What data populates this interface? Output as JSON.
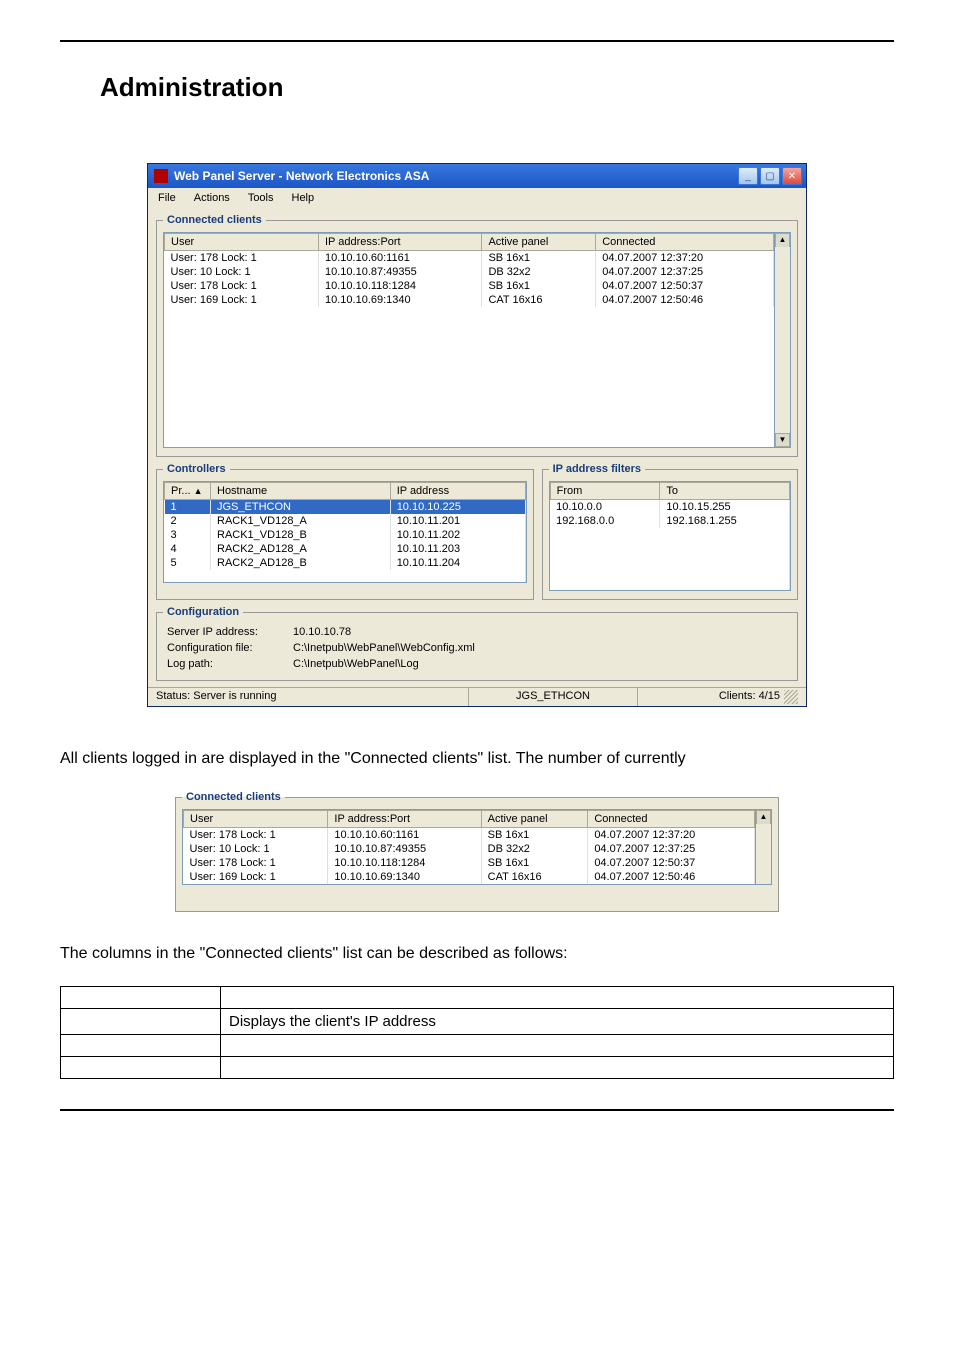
{
  "page": {
    "heading": "Administration"
  },
  "window": {
    "title": "Web Panel Server - Network Electronics ASA",
    "menu": {
      "file": "File",
      "actions": "Actions",
      "tools": "Tools",
      "help": "Help"
    }
  },
  "connected_clients": {
    "legend": "Connected clients",
    "headers": {
      "user": "User",
      "ip": "IP address:Port",
      "panel": "Active panel",
      "conn": "Connected"
    },
    "rows": [
      {
        "user": "User: 178 Lock: 1",
        "ip": "10.10.10.60:1161",
        "panel": "SB 16x1",
        "conn": "04.07.2007 12:37:20"
      },
      {
        "user": "User: 10 Lock: 1",
        "ip": "10.10.10.87:49355",
        "panel": "DB 32x2",
        "conn": "04.07.2007 12:37:25"
      },
      {
        "user": "User: 178 Lock: 1",
        "ip": "10.10.10.118:1284",
        "panel": "SB 16x1",
        "conn": "04.07.2007 12:50:37"
      },
      {
        "user": "User: 169 Lock: 1",
        "ip": "10.10.10.69:1340",
        "panel": "CAT 16x16",
        "conn": "04.07.2007 12:50:46"
      }
    ]
  },
  "controllers": {
    "legend": "Controllers",
    "headers": {
      "pr": "Pr...",
      "host": "Hostname",
      "ip": "IP address",
      "sort": "▲"
    },
    "rows": [
      {
        "pr": "1",
        "host": "JGS_ETHCON",
        "ip": "10.10.10.225"
      },
      {
        "pr": "2",
        "host": "RACK1_VD128_A",
        "ip": "10.10.11.201"
      },
      {
        "pr": "3",
        "host": "RACK1_VD128_B",
        "ip": "10.10.11.202"
      },
      {
        "pr": "4",
        "host": "RACK2_AD128_A",
        "ip": "10.10.11.203"
      },
      {
        "pr": "5",
        "host": "RACK2_AD128_B",
        "ip": "10.10.11.204"
      }
    ]
  },
  "filters": {
    "legend": "IP address filters",
    "headers": {
      "from": "From",
      "to": "To"
    },
    "rows": [
      {
        "from": "10.10.0.0",
        "to": "10.10.15.255"
      },
      {
        "from": "192.168.0.0",
        "to": "192.168.1.255"
      }
    ]
  },
  "configuration": {
    "legend": "Configuration",
    "labels": {
      "server_ip": "Server IP address:",
      "config_file": "Configuration file:",
      "log_path": "Log path:"
    },
    "values": {
      "server_ip": "10.10.10.78",
      "config_file": "C:\\Inetpub\\WebPanel\\WebConfig.xml",
      "log_path": "C:\\Inetpub\\WebPanel\\Log"
    }
  },
  "statusbar": {
    "status": "Status: Server is running",
    "device": "JGS_ETHCON",
    "clients": "Clients: 4/15"
  },
  "text": {
    "para1": "All clients logged in are displayed in the \"Connected clients\" list. The number of currently",
    "para2": "The columns in the \"Connected clients\" list can be described as follows:"
  },
  "desc_table": {
    "rows": [
      {
        "c1": "",
        "c2": ""
      },
      {
        "c1": "",
        "c2": "Displays the client's IP address"
      },
      {
        "c1": "",
        "c2": ""
      },
      {
        "c1": "",
        "c2": ""
      }
    ]
  },
  "chart_data": {
    "type": "table",
    "title": "Connected clients",
    "columns": [
      "User",
      "IP address:Port",
      "Active panel",
      "Connected"
    ],
    "rows": [
      [
        "User: 178 Lock: 1",
        "10.10.10.60:1161",
        "SB 16x1",
        "04.07.2007 12:37:20"
      ],
      [
        "User: 10 Lock: 1",
        "10.10.10.87:49355",
        "DB 32x2",
        "04.07.2007 12:37:25"
      ],
      [
        "User: 178 Lock: 1",
        "10.10.10.118:1284",
        "SB 16x1",
        "04.07.2007 12:50:37"
      ],
      [
        "User: 169 Lock: 1",
        "10.10.10.69:1340",
        "CAT 16x16",
        "04.07.2007 12:50:46"
      ]
    ]
  }
}
